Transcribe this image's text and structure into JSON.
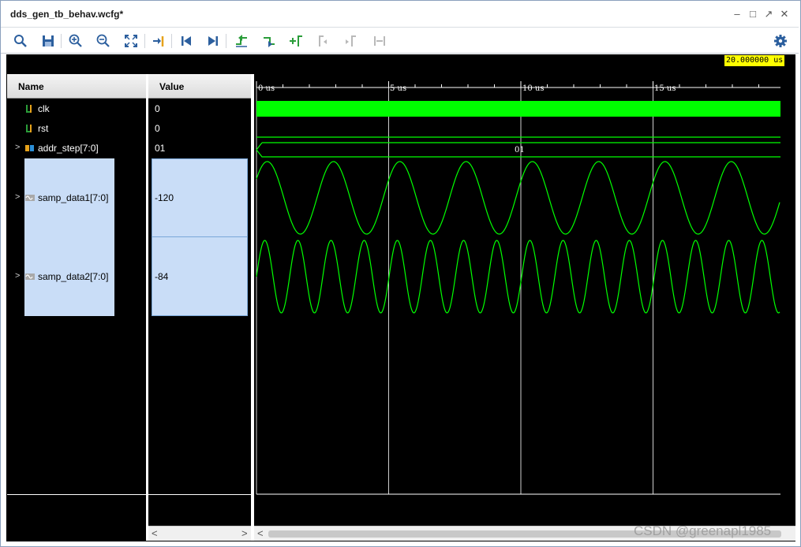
{
  "window": {
    "title": "dds_gen_tb_behav.wcfg*"
  },
  "toolbar": {
    "icons": [
      "search-icon",
      "save-icon",
      "zoom-in-icon",
      "zoom-out-icon",
      "zoom-fit-icon",
      "go-to-cursor-icon",
      "go-to-time-0-icon",
      "go-to-last-time-icon",
      "previous-transition-icon",
      "next-transition-icon",
      "add-marker-icon",
      "previous-marker-icon",
      "next-marker-icon",
      "swap-cursors-icon",
      "settings-icon"
    ]
  },
  "columns": {
    "name": "Name",
    "value": "Value"
  },
  "signals": [
    {
      "name": "clk",
      "value": "0",
      "type": "bit"
    },
    {
      "name": "rst",
      "value": "0",
      "type": "bit"
    },
    {
      "name": "addr_step[7:0]",
      "value": "01",
      "type": "bus"
    },
    {
      "name": "samp_data1[7:0]",
      "value": "-120",
      "type": "analog"
    },
    {
      "name": "samp_data2[7:0]",
      "value": "-84",
      "type": "analog"
    }
  ],
  "timeline": {
    "cursor": "20.000000 us",
    "ticks": [
      "0 us",
      "5 us",
      "10 us",
      "15 us"
    ],
    "bus_value": "01"
  },
  "colors": {
    "wave": "#00ff00",
    "background": "#000000",
    "selection": "#c9ddf7",
    "cursor": "#ffff00"
  },
  "watermark": "CSDN @greenapl1985"
}
